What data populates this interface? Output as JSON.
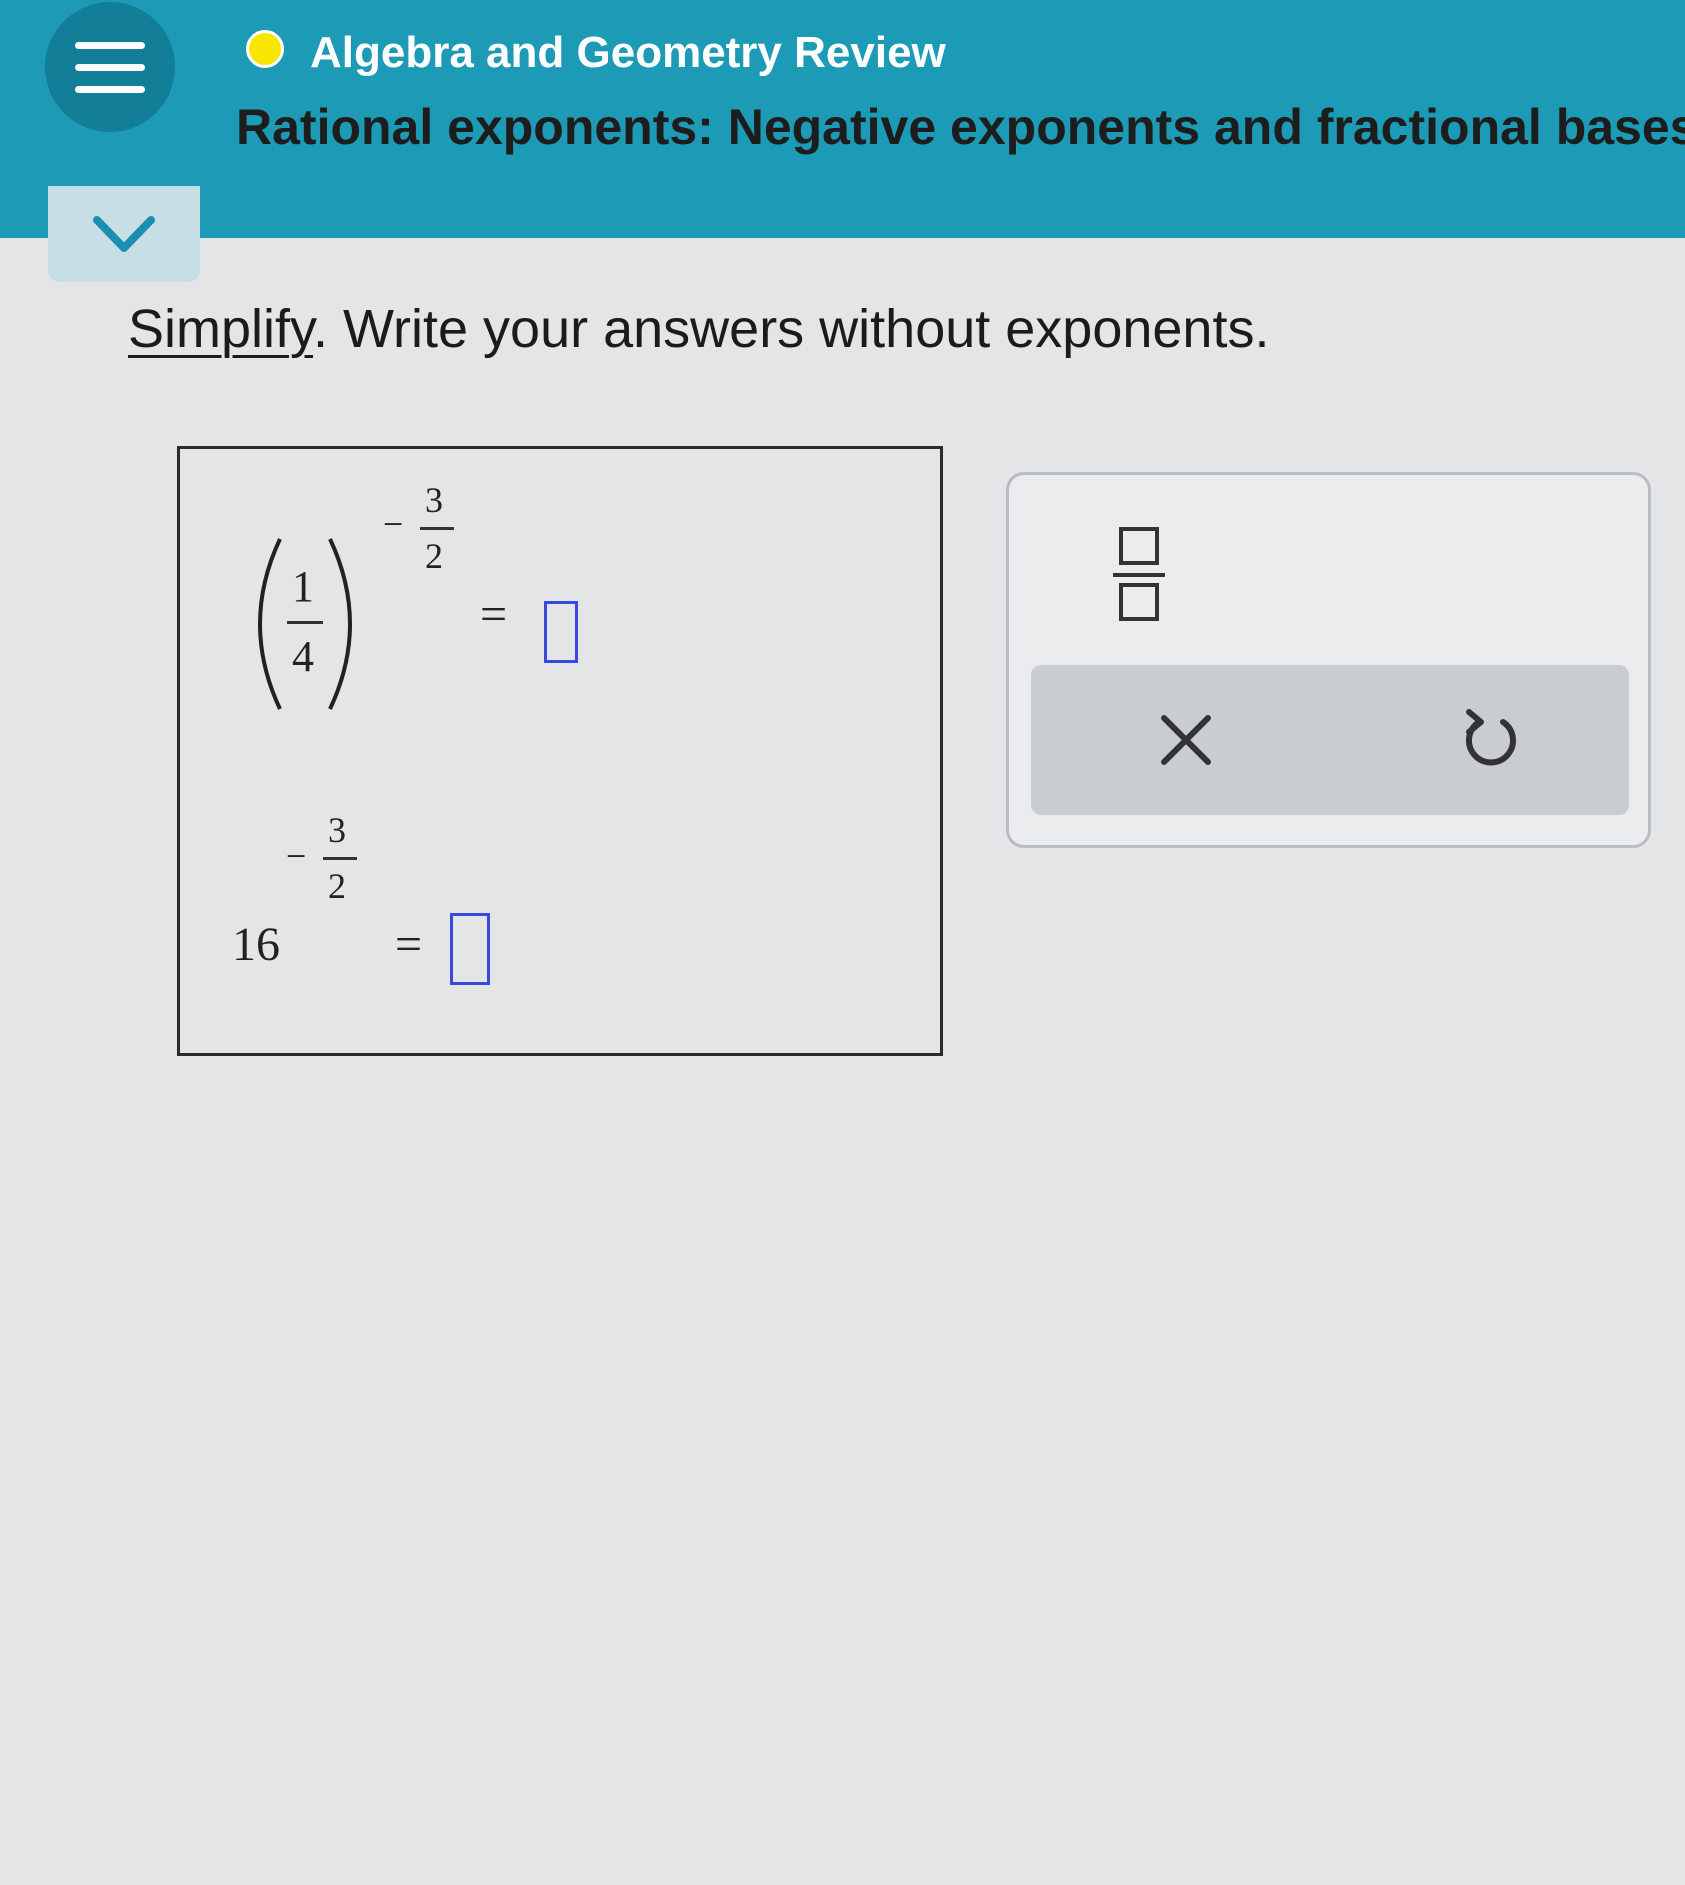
{
  "header": {
    "course_title": "Algebra and Geometry Review",
    "topic_title": "Rational exponents: Negative exponents and fractional bases",
    "status_color": "#f7e600",
    "accent_color": "#1c9ab6"
  },
  "instruction": {
    "link_text": "Simplify",
    "rest_text": ". Write your answers without exponents."
  },
  "problem1": {
    "base_numerator": "1",
    "base_denominator": "4",
    "exponent_sign": "−",
    "exponent_numerator": "3",
    "exponent_denominator": "2",
    "equals": "=",
    "answer": ""
  },
  "problem2": {
    "base": "16",
    "exponent_sign": "−",
    "exponent_numerator": "3",
    "exponent_denominator": "2",
    "equals": "=",
    "answer": ""
  },
  "toolbar": {
    "fraction_tool": "fraction-template-icon",
    "clear_icon": "close-icon",
    "undo_icon": "undo-icon"
  }
}
